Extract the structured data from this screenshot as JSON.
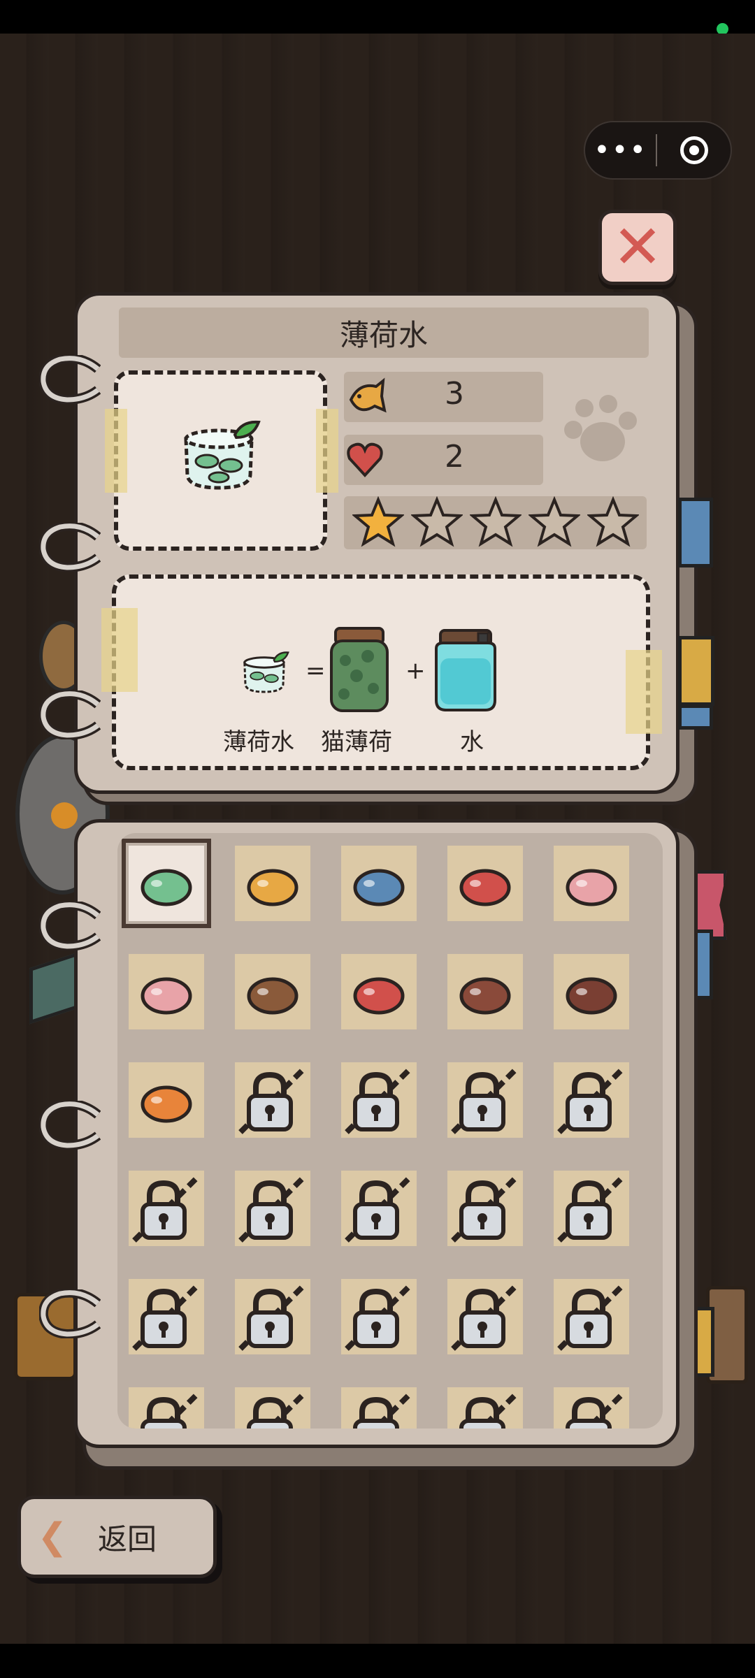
{
  "capsule": {
    "more_icon": "more-dots-icon",
    "target_icon": "target-icon"
  },
  "close_icon": "close-x-icon",
  "recipe": {
    "name": "薄荷水",
    "cost": "3",
    "hearts": "2",
    "stars_filled": 1,
    "stars_total": 5
  },
  "formula": {
    "result_label": "薄荷水",
    "equals": "=",
    "plus": "+",
    "ingredients": [
      {
        "label": "猫薄荷",
        "icon": "catnip-jar-icon"
      },
      {
        "label": "水",
        "icon": "water-jar-icon"
      }
    ]
  },
  "grid": {
    "items": [
      {
        "name": "mint-water",
        "locked": false,
        "selected": true
      },
      {
        "name": "chicken-plate",
        "locked": false
      },
      {
        "name": "fish-skewer",
        "locked": false
      },
      {
        "name": "shrimp-skewer",
        "locked": false
      },
      {
        "name": "meat-skewer",
        "locked": false
      },
      {
        "name": "sausage-skewer",
        "locked": false
      },
      {
        "name": "mushroom-skewer",
        "locked": false
      },
      {
        "name": "lobster",
        "locked": false
      },
      {
        "name": "steak",
        "locked": false
      },
      {
        "name": "grilled-steak",
        "locked": false
      },
      {
        "name": "fried-chicken",
        "locked": false
      },
      {
        "locked": true
      },
      {
        "locked": true
      },
      {
        "locked": true
      },
      {
        "locked": true
      },
      {
        "locked": true
      },
      {
        "locked": true
      },
      {
        "locked": true
      },
      {
        "locked": true
      },
      {
        "locked": true
      },
      {
        "locked": true
      },
      {
        "locked": true
      },
      {
        "locked": true
      },
      {
        "locked": true
      },
      {
        "locked": true
      },
      {
        "locked": true
      },
      {
        "locked": true
      },
      {
        "locked": true
      },
      {
        "locked": true
      },
      {
        "locked": true
      }
    ]
  },
  "back_button": {
    "label": "返回"
  },
  "colors": {
    "accent_star": "#f2b13e",
    "heart": "#d1504b",
    "tab_blue": "#5b89b5",
    "tab_yellow": "#d8aa45",
    "tab_pink": "#c8566a"
  }
}
